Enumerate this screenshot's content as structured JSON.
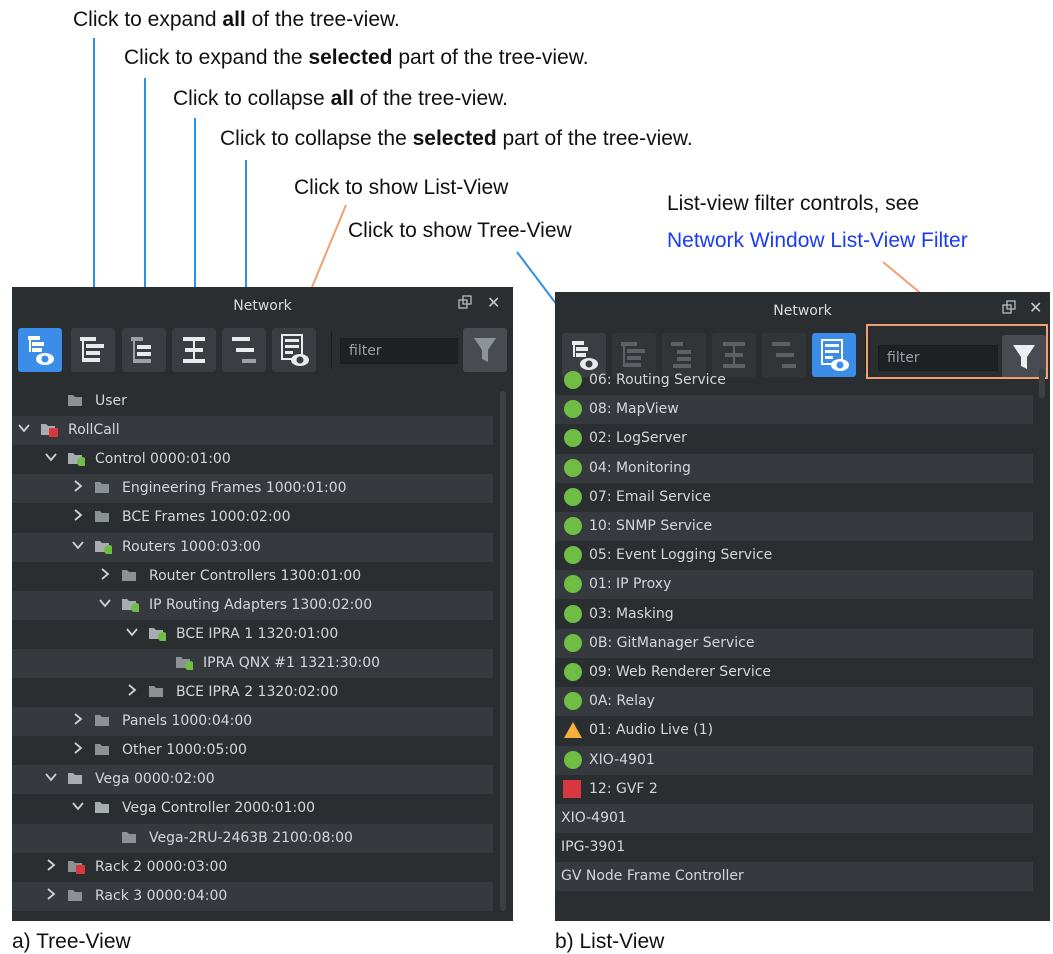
{
  "annotations": {
    "expand_all": {
      "pre": "Click to expand ",
      "bold": "all",
      "post": " of the tree-view."
    },
    "expand_selected": {
      "pre": "Click to expand the ",
      "bold": "selected",
      "post": " part of the tree-view."
    },
    "collapse_all": {
      "pre": "Click to collapse ",
      "bold": "all",
      "post": " of the tree-view."
    },
    "collapse_selected": {
      "pre": "Click to collapse the ",
      "bold": "selected",
      "post": " part of the tree-view."
    },
    "show_list": "Click to show List-View",
    "show_tree": "Click to show Tree-View",
    "filter_controls": "List-view filter controls, see",
    "filter_link": "Network Window List-View Filter"
  },
  "captions": {
    "tree": "a) Tree-View",
    "list": "b) List-View"
  },
  "panel": {
    "title": "Network",
    "filter_placeholder": "filter"
  },
  "colors": {
    "accent": "#3b8de8",
    "ok": "#6fbd45",
    "warn": "#f4b03f",
    "error": "#d8383d",
    "annotation_line_blue": "#2c8fe8",
    "annotation_line_orange": "#f0a070",
    "link": "#1a3cf0"
  },
  "tree": [
    {
      "label": "User",
      "status": "none",
      "chevron": "none"
    },
    {
      "label": "RollCall",
      "status": "error",
      "chevron": "down"
    },
    {
      "label": "Control 0000:01:00",
      "status": "ok",
      "chevron": "down"
    },
    {
      "label": "Engineering Frames 1000:01:00",
      "status": "none",
      "chevron": "right"
    },
    {
      "label": "BCE Frames 1000:02:00",
      "status": "none",
      "chevron": "right"
    },
    {
      "label": "Routers 1000:03:00",
      "status": "ok",
      "chevron": "down"
    },
    {
      "label": "Router Controllers 1300:01:00",
      "status": "none",
      "chevron": "right"
    },
    {
      "label": "IP Routing Adapters 1300:02:00",
      "status": "ok",
      "chevron": "down"
    },
    {
      "label": "BCE IPRA 1 1320:01:00",
      "status": "ok",
      "chevron": "down"
    },
    {
      "label": "IPRA QNX #1 1321:30:00",
      "status": "ok",
      "chevron": "none"
    },
    {
      "label": "BCE IPRA 2 1320:02:00",
      "status": "none",
      "chevron": "right"
    },
    {
      "label": "Panels 1000:04:00",
      "status": "none",
      "chevron": "right"
    },
    {
      "label": "Other 1000:05:00",
      "status": "none",
      "chevron": "right"
    },
    {
      "label": "Vega 0000:02:00",
      "status": "none",
      "chevron": "down"
    },
    {
      "label": "Vega Controller 2000:01:00",
      "status": "none",
      "chevron": "down"
    },
    {
      "label": "Vega-2RU-2463B 2100:08:00",
      "status": "none",
      "chevron": "none"
    },
    {
      "label": "Rack 2 0000:03:00",
      "status": "error",
      "chevron": "right"
    },
    {
      "label": "Rack 3 0000:04:00",
      "status": "none",
      "chevron": "right"
    }
  ],
  "list": [
    {
      "label": "06: Routing Service",
      "status": "ok"
    },
    {
      "label": "08: MapView",
      "status": "ok"
    },
    {
      "label": "02: LogServer",
      "status": "ok"
    },
    {
      "label": "04: Monitoring",
      "status": "ok"
    },
    {
      "label": "07: Email Service",
      "status": "ok"
    },
    {
      "label": "10: SNMP Service",
      "status": "ok"
    },
    {
      "label": "05: Event Logging Service",
      "status": "ok"
    },
    {
      "label": "01: IP Proxy",
      "status": "ok"
    },
    {
      "label": "03: Masking",
      "status": "ok"
    },
    {
      "label": "0B: GitManager Service",
      "status": "ok"
    },
    {
      "label": "09: Web Renderer Service",
      "status": "ok"
    },
    {
      "label": "0A: Relay",
      "status": "ok"
    },
    {
      "label": "01: Audio Live (1)",
      "status": "warn"
    },
    {
      "label": "XIO-4901",
      "status": "ok"
    },
    {
      "label": "12: GVF 2",
      "status": "error"
    },
    {
      "label": "XIO-4901",
      "status": "none"
    },
    {
      "label": "IPG-3901",
      "status": "none"
    },
    {
      "label": "GV Node Frame Controller",
      "status": "none"
    }
  ]
}
